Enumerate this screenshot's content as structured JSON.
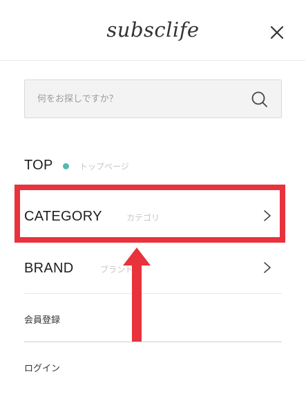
{
  "header": {
    "logo_text": "subsclife",
    "close_icon": "close-icon"
  },
  "search": {
    "placeholder": "何をお探しですか？",
    "icon": "search-icon"
  },
  "nav": {
    "top": {
      "label": "TOP",
      "sublabel": "トップページ",
      "dot_color": "#57b8b4"
    },
    "category": {
      "label": "CATEGORY",
      "sublabel": "カテゴリ",
      "icon": "chevron-right-icon"
    },
    "brand": {
      "label": "BRAND",
      "sublabel": "ブランド",
      "icon": "chevron-right-icon"
    }
  },
  "links": {
    "register": "会員登録",
    "login": "ログイン"
  },
  "annotation": {
    "highlight_color": "#e8323c",
    "arrow_icon": "arrow-up-icon"
  }
}
